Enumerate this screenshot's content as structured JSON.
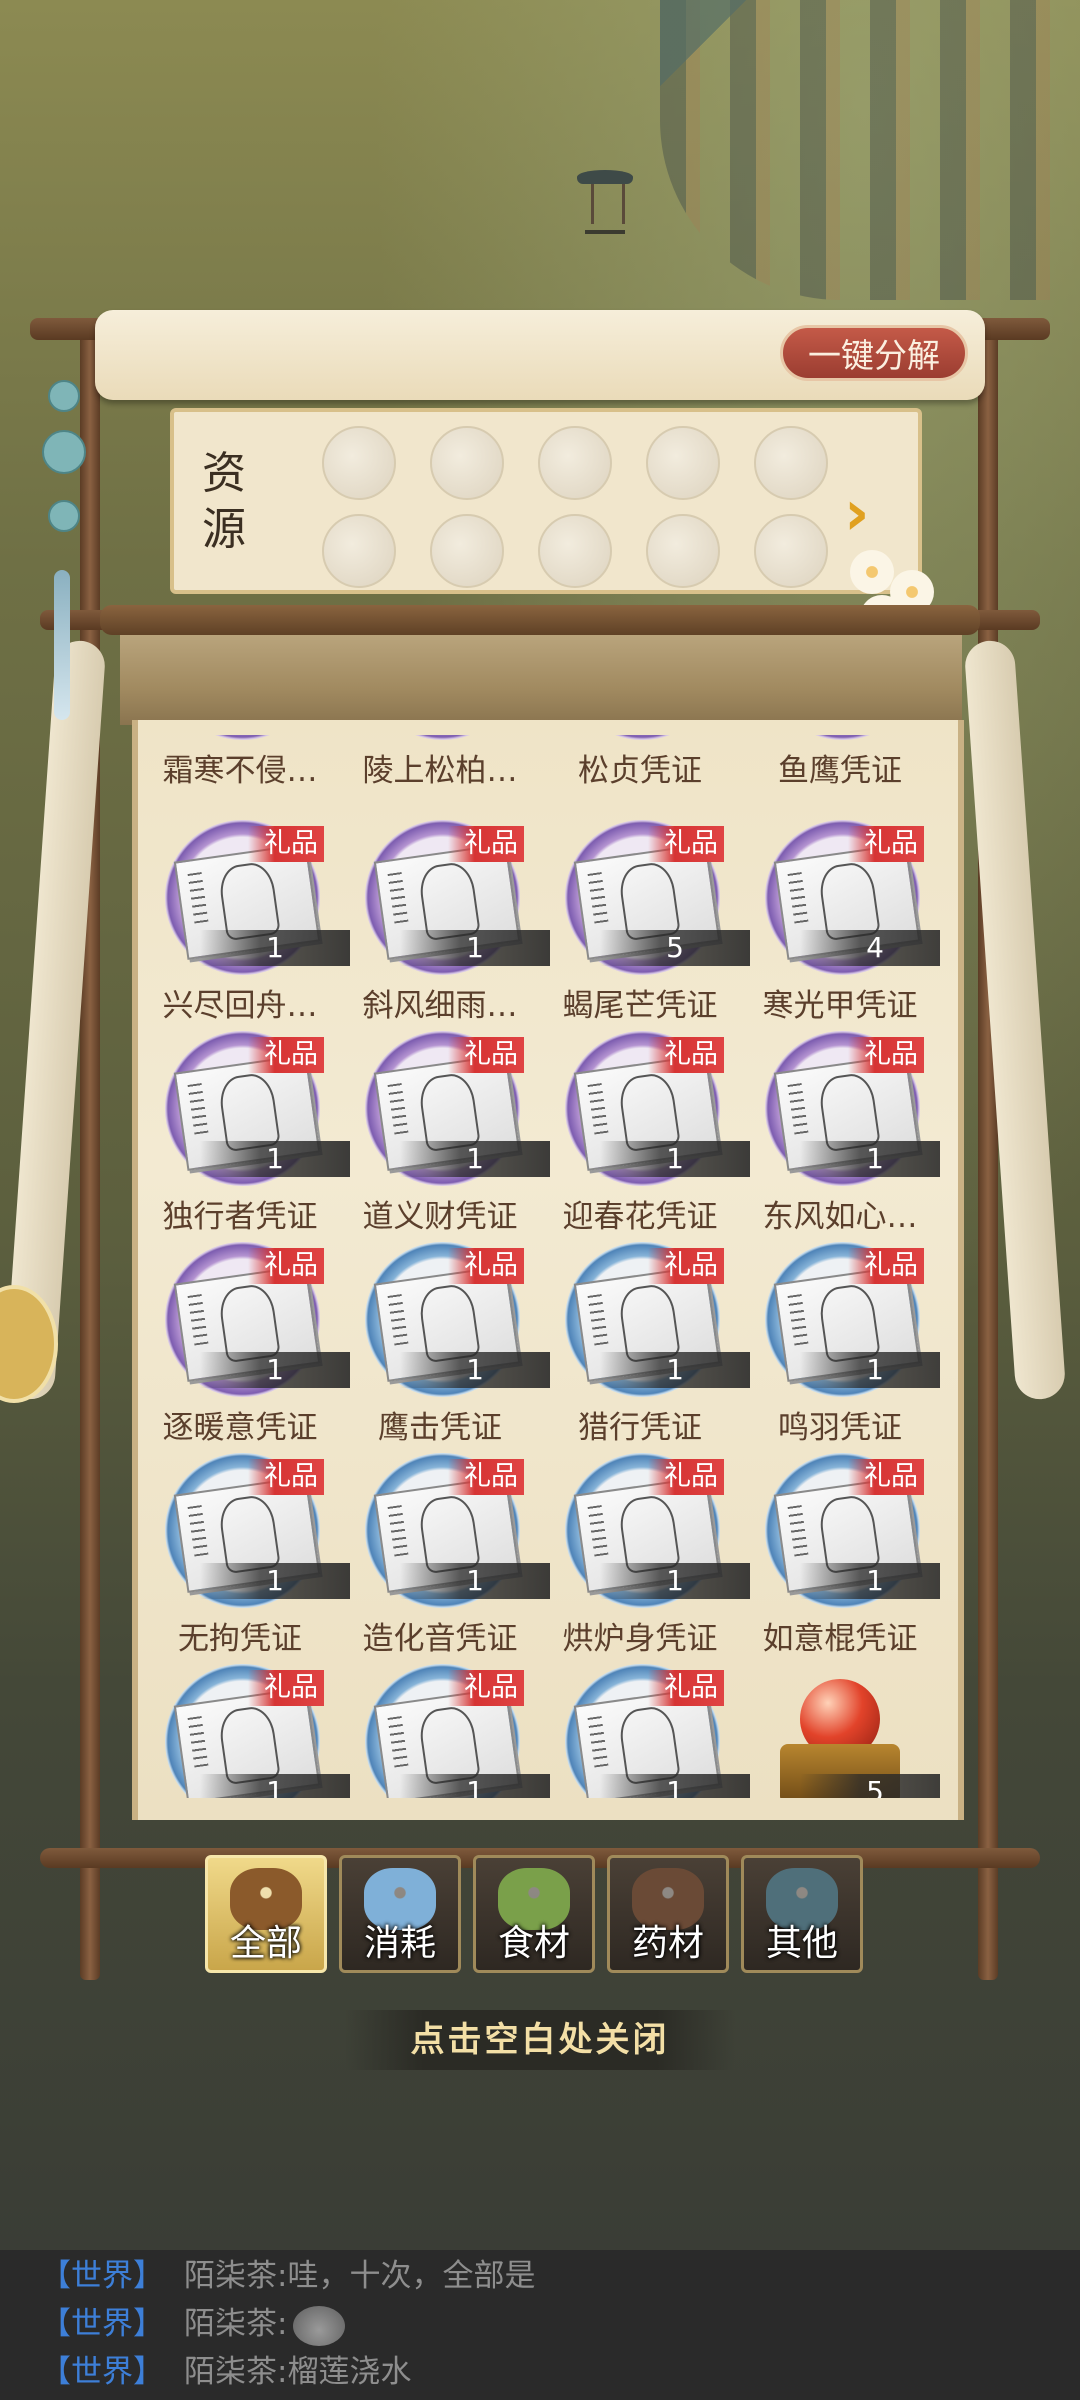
{
  "header": {
    "disassemble_label": "一键分解"
  },
  "resources": {
    "label": "资\n源",
    "slot_count": 10,
    "arrow": "›"
  },
  "top_row_names": [
    "霜寒不侵…",
    "陵上松柏…",
    "松贞凭证",
    "鱼鹰凭证"
  ],
  "gift_tag": "礼品",
  "items": [
    {
      "name": "兴尽回舟…",
      "count": "1",
      "ring": "purple",
      "gift": true
    },
    {
      "name": "斜风细雨…",
      "count": "1",
      "ring": "purple",
      "gift": true
    },
    {
      "name": "蝎尾芒凭证",
      "count": "5",
      "ring": "purple",
      "gift": true
    },
    {
      "name": "寒光甲凭证",
      "count": "4",
      "ring": "purple",
      "gift": true
    },
    {
      "name": "独行者凭证",
      "count": "1",
      "ring": "purple",
      "gift": true
    },
    {
      "name": "道义财凭证",
      "count": "1",
      "ring": "purple",
      "gift": true
    },
    {
      "name": "迎春花凭证",
      "count": "1",
      "ring": "purple",
      "gift": true
    },
    {
      "name": "东风如心…",
      "count": "1",
      "ring": "purple",
      "gift": true
    },
    {
      "name": "逐暖意凭证",
      "count": "1",
      "ring": "purple",
      "gift": true
    },
    {
      "name": "鹰击凭证",
      "count": "1",
      "ring": "blue",
      "gift": true
    },
    {
      "name": "猎行凭证",
      "count": "1",
      "ring": "blue",
      "gift": true
    },
    {
      "name": "鸣羽凭证",
      "count": "1",
      "ring": "blue",
      "gift": true
    },
    {
      "name": "无拘凭证",
      "count": "1",
      "ring": "blue",
      "gift": true
    },
    {
      "name": "造化音凭证",
      "count": "1",
      "ring": "blue",
      "gift": true
    },
    {
      "name": "烘炉身凭证",
      "count": "1",
      "ring": "blue",
      "gift": true
    },
    {
      "name": "如意棍凭证",
      "count": "1",
      "ring": "blue",
      "gift": true
    },
    {
      "name": "",
      "count": "1",
      "ring": "blue",
      "gift": true
    },
    {
      "name": "",
      "count": "1",
      "ring": "blue",
      "gift": true
    },
    {
      "name": "",
      "count": "1",
      "ring": "blue",
      "gift": true
    },
    {
      "name": "",
      "count": "5",
      "ring": "orb",
      "gift": false
    }
  ],
  "tabs": [
    {
      "label": "全部",
      "active": true,
      "icon": "treasure-chest-icon"
    },
    {
      "label": "消耗",
      "active": false,
      "icon": "potion-icon"
    },
    {
      "label": "食材",
      "active": false,
      "icon": "vegetable-basket-icon"
    },
    {
      "label": "药材",
      "active": false,
      "icon": "herb-pot-icon"
    },
    {
      "label": "其他",
      "active": false,
      "icon": "jar-icon"
    }
  ],
  "close_hint": "点击空白处关闭",
  "chat": [
    {
      "channel": "【世界】",
      "sender": "陌柒茶:",
      "message": "哇，十次，全部是",
      "emoji": false
    },
    {
      "channel": "【世界】",
      "sender": "陌柒茶:",
      "message": "",
      "emoji": true
    },
    {
      "channel": "【世界】",
      "sender": "陌柒茶:",
      "message": "榴莲浇水",
      "emoji": false
    }
  ],
  "colors": {
    "gift_red": "#d63434",
    "purple_ring": "#7d5db0",
    "blue_ring": "#4f84b8",
    "channel_blue": "#3d7fd8"
  }
}
